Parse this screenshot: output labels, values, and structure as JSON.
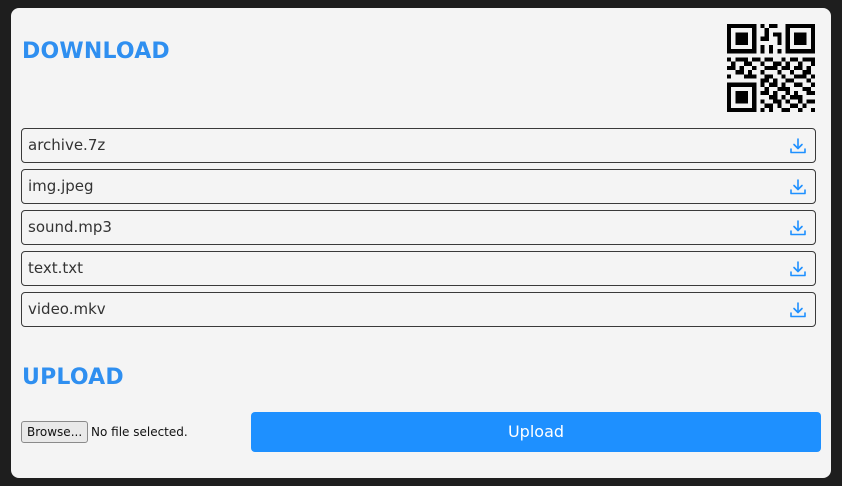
{
  "download": {
    "title": "DOWNLOAD",
    "files": [
      {
        "name": "archive.7z",
        "icon": "download-icon"
      },
      {
        "name": "img.jpeg",
        "icon": "download-icon"
      },
      {
        "name": "sound.mp3",
        "icon": "download-icon"
      },
      {
        "name": "text.txt",
        "icon": "download-icon"
      },
      {
        "name": "video.mkv",
        "icon": "download-icon"
      }
    ]
  },
  "upload": {
    "title": "UPLOAD",
    "browse_label": "Browse...",
    "file_status": "No file selected.",
    "submit_label": "Upload"
  },
  "colors": {
    "accent": "#1e90ff",
    "title": "#2f8ff0",
    "card": "#f4f4f4",
    "background": "#1e1e1e"
  },
  "icons": {
    "qr": "qr-code-icon",
    "download": "download-icon"
  }
}
